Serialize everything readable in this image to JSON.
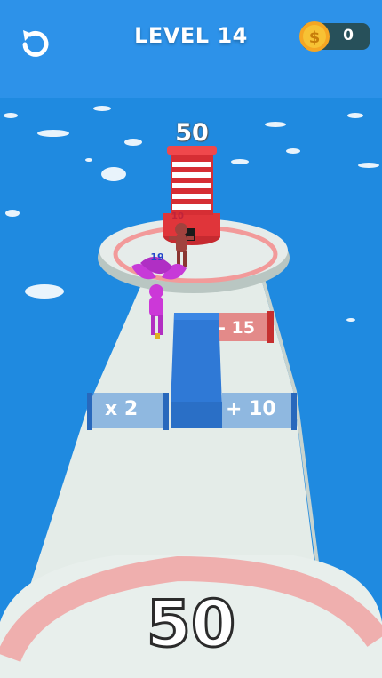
{
  "hud": {
    "level_label": "LEVEL 14",
    "coins": "0",
    "restart_icon": "restart-icon",
    "coin_icon": "dollar-coin-icon"
  },
  "tower": {
    "count": "50"
  },
  "enemy": {
    "count": "10"
  },
  "player": {
    "count": "19"
  },
  "gates": {
    "left": "x 2",
    "right": "+ 10",
    "far": "- 15"
  },
  "player_counter": "50",
  "colors": {
    "sky": "#1f8ae0",
    "platform": "#e4ece8",
    "ring": "#f08c8c",
    "gate_blue": "#2f79d6",
    "gate_red": "#e23b3b",
    "tower_red": "#e0353a",
    "character_pink": "#cc38d8",
    "enemy_brown": "#a0423e"
  }
}
